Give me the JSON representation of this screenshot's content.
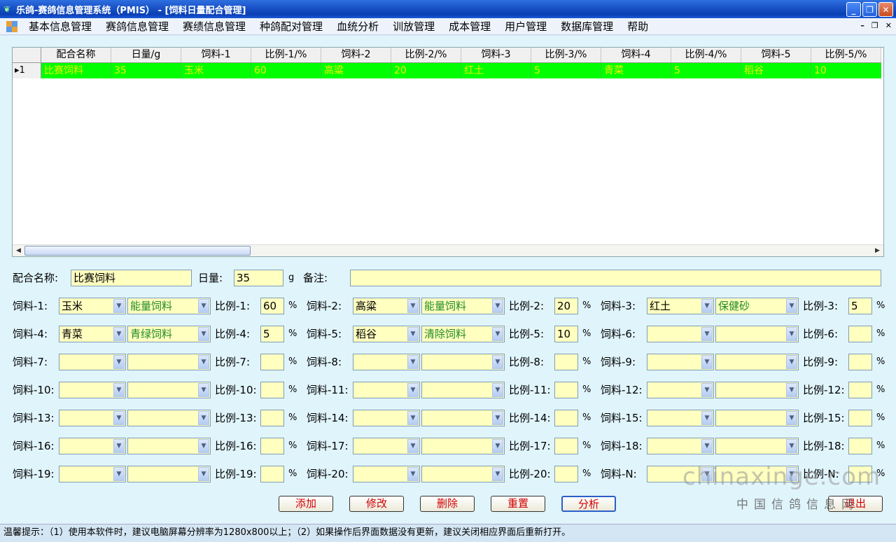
{
  "window": {
    "title": "乐鸽-赛鸽信息管理系统（PMIS） - [饲料日量配合管理]",
    "minimize_glyph": "_",
    "restore_glyph": "❐",
    "close_glyph": "✕"
  },
  "menu": {
    "items": [
      "基本信息管理",
      "赛鸽信息管理",
      "赛绩信息管理",
      "种鸽配对管理",
      "血统分析",
      "训放管理",
      "成本管理",
      "用户管理",
      "数据库管理",
      "帮助"
    ],
    "mdi_minimize": "–",
    "mdi_restore": "❐",
    "mdi_close": "✕"
  },
  "grid": {
    "columns": [
      "配合名称",
      "日量/g",
      "饲料-1",
      "比例-1/%",
      "饲料-2",
      "比例-2/%",
      "饲料-3",
      "比例-3/%",
      "饲料-4",
      "比例-4/%",
      "饲料-5",
      "比例-5/%"
    ],
    "rows": [
      {
        "row_header": "▸1",
        "cells": [
          "比赛饲料",
          "35",
          "玉米",
          "60",
          "高粱",
          "20",
          "红土",
          "5",
          "青菜",
          "5",
          "稻谷",
          "10"
        ]
      }
    ],
    "selected_row_color": "#00ff00",
    "scroll_left": "◀",
    "scroll_right": "▶"
  },
  "form": {
    "name_label": "配合名称:",
    "name_value": "比赛饲料",
    "daily_label": "日量:",
    "daily_value": "35",
    "daily_unit": "g",
    "remark_label": "备注:",
    "remark_value": "",
    "percent_sign": "%",
    "dropdown_glyph": "▼",
    "feeds": [
      {
        "label": "饲料-1:",
        "feed": "玉米",
        "category": "能量饲料",
        "ratio_label": "比例-1:",
        "ratio": "60"
      },
      {
        "label": "饲料-2:",
        "feed": "高粱",
        "category": "能量饲料",
        "ratio_label": "比例-2:",
        "ratio": "20"
      },
      {
        "label": "饲料-3:",
        "feed": "红土",
        "category": "保健砂",
        "ratio_label": "比例-3:",
        "ratio": "5"
      },
      {
        "label": "饲料-4:",
        "feed": "青菜",
        "category": "青绿饲料",
        "ratio_label": "比例-4:",
        "ratio": "5"
      },
      {
        "label": "饲料-5:",
        "feed": "稻谷",
        "category": "清除饲料",
        "ratio_label": "比例-5:",
        "ratio": "10"
      },
      {
        "label": "饲料-6:",
        "feed": "",
        "category": "",
        "ratio_label": "比例-6:",
        "ratio": ""
      },
      {
        "label": "饲料-7:",
        "feed": "",
        "category": "",
        "ratio_label": "比例-7:",
        "ratio": ""
      },
      {
        "label": "饲料-8:",
        "feed": "",
        "category": "",
        "ratio_label": "比例-8:",
        "ratio": ""
      },
      {
        "label": "饲料-9:",
        "feed": "",
        "category": "",
        "ratio_label": "比例-9:",
        "ratio": ""
      },
      {
        "label": "饲料-10:",
        "feed": "",
        "category": "",
        "ratio_label": "比例-10:",
        "ratio": ""
      },
      {
        "label": "饲料-11:",
        "feed": "",
        "category": "",
        "ratio_label": "比例-11:",
        "ratio": ""
      },
      {
        "label": "饲料-12:",
        "feed": "",
        "category": "",
        "ratio_label": "比例-12:",
        "ratio": ""
      },
      {
        "label": "饲料-13:",
        "feed": "",
        "category": "",
        "ratio_label": "比例-13:",
        "ratio": ""
      },
      {
        "label": "饲料-14:",
        "feed": "",
        "category": "",
        "ratio_label": "比例-14:",
        "ratio": ""
      },
      {
        "label": "饲料-15:",
        "feed": "",
        "category": "",
        "ratio_label": "比例-15:",
        "ratio": ""
      },
      {
        "label": "饲料-16:",
        "feed": "",
        "category": "",
        "ratio_label": "比例-16:",
        "ratio": ""
      },
      {
        "label": "饲料-17:",
        "feed": "",
        "category": "",
        "ratio_label": "比例-17:",
        "ratio": ""
      },
      {
        "label": "饲料-18:",
        "feed": "",
        "category": "",
        "ratio_label": "比例-18:",
        "ratio": ""
      },
      {
        "label": "饲料-19:",
        "feed": "",
        "category": "",
        "ratio_label": "比例-19:",
        "ratio": ""
      },
      {
        "label": "饲料-20:",
        "feed": "",
        "category": "",
        "ratio_label": "比例-20:",
        "ratio": ""
      },
      {
        "label": "饲料-N:",
        "feed": "",
        "category": "",
        "ratio_label": "比例-N:",
        "ratio": ""
      }
    ]
  },
  "buttons": {
    "add": "添加",
    "edit": "修改",
    "delete": "删除",
    "reset": "重置",
    "analyze": "分析",
    "exit": "退出"
  },
  "watermark": {
    "main": "chinaxinge.com",
    "sub": "中国信鸽信息网"
  },
  "status": {
    "text": "温馨提示：（1）使用本软件时，建议电脑屏幕分辨率为1280x800以上；（2）如果操作后界面数据没有更新，建议关闭相应界面后重新打开。"
  },
  "colors": {
    "input_bg": "#ffffc0",
    "button_text": "#d00000",
    "panel_bg": "#e0f4fb",
    "category_text": "#228b22",
    "grid_row_text": "#f0f000"
  }
}
